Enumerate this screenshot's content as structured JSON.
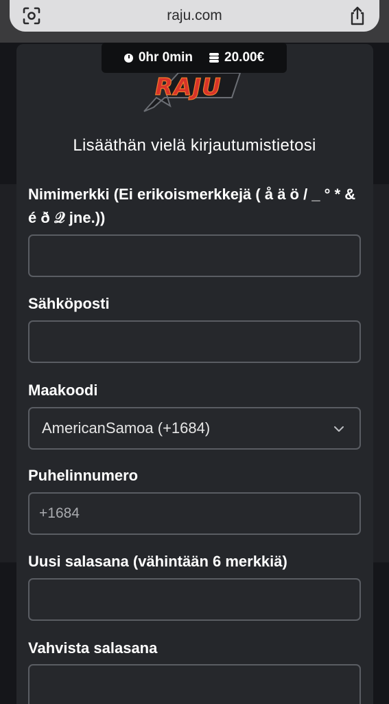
{
  "browser": {
    "url": "raju.com",
    "left_icon": "scan-icon",
    "right_icon": "share-icon"
  },
  "session": {
    "time": "0hr 0min",
    "balance": "20.00€"
  },
  "brand": {
    "logo_text": "RAJU"
  },
  "form": {
    "subtitle": "Lisääthän vielä kirjautumistietosi",
    "nickname_label": "Nimimerkki (Ei erikoismerkkejä ( å ä ö / _ ° * & é ð 𝒬 jne.))",
    "nickname_value": "",
    "email_label": "Sähköposti",
    "email_value": "",
    "country_label": "Maakoodi",
    "country_value": "AmericanSamoa (+1684)",
    "phone_label": "Puhelinnumero",
    "phone_placeholder": "+1684",
    "password_label": "Uusi salasana (vähintään 6 merkkiä)",
    "password_value": "",
    "confirm_label": "Vahvista salasana",
    "confirm_value": ""
  },
  "colors": {
    "page_bg": "#15161a",
    "card_bg": "#25272b",
    "input_border": "#5a5d63",
    "logo_red": "#d8332a",
    "logo_orange": "#f07a2a"
  }
}
